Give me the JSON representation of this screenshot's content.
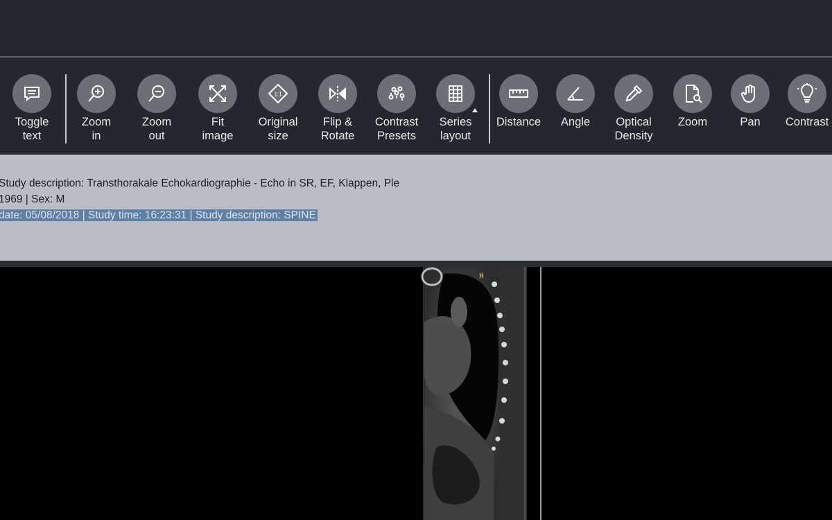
{
  "toolbar": {
    "groups": [
      [
        {
          "id": "toggle-text",
          "label": "Toggle\ntext",
          "icon": "toggle-text-icon"
        }
      ],
      [
        {
          "id": "zoom-in",
          "label": "Zoom\nin",
          "icon": "zoom-in-icon"
        },
        {
          "id": "zoom-out",
          "label": "Zoom\nout",
          "icon": "zoom-out-icon"
        },
        {
          "id": "fit-image",
          "label": "Fit\nimage",
          "icon": "fit-image-icon"
        },
        {
          "id": "original-size",
          "label": "Original\nsize",
          "icon": "original-size-icon"
        },
        {
          "id": "flip-rotate",
          "label": "Flip &\nRotate",
          "icon": "flip-rotate-icon"
        },
        {
          "id": "contrast-presets",
          "label": "Contrast\nPresets",
          "icon": "contrast-presets-icon"
        },
        {
          "id": "series-layout",
          "label": "Series\nlayout",
          "icon": "series-layout-icon"
        }
      ],
      [
        {
          "id": "distance",
          "label": "Distance",
          "icon": "ruler-icon"
        },
        {
          "id": "angle",
          "label": "Angle",
          "icon": "angle-icon"
        },
        {
          "id": "optical-density",
          "label": "Optical\nDensity",
          "icon": "pipette-icon"
        },
        {
          "id": "zoom-tool",
          "label": "Zoom",
          "icon": "zoom-document-icon"
        },
        {
          "id": "pan",
          "label": "Pan",
          "icon": "hand-icon"
        },
        {
          "id": "contrast",
          "label": "Contrast",
          "icon": "lightbulb-icon"
        }
      ]
    ],
    "original_size_glyph": "1:1"
  },
  "info": {
    "line1": "Study description: Transthorakale Echokardiographie -  Echo in SR, EF, Klappen, Ple",
    "line2": "1969 | Sex: M",
    "line3": "date: 05/08/2018 | Study time: 16:23:31 | Study description: SPINE"
  },
  "viewer": {
    "orientation_marker": "H"
  },
  "colors": {
    "toolbar_bg": "#24272e",
    "icon_bg": "#6b6f76",
    "info_bg": "#b8bec4",
    "selection": "#5f7fa4"
  }
}
